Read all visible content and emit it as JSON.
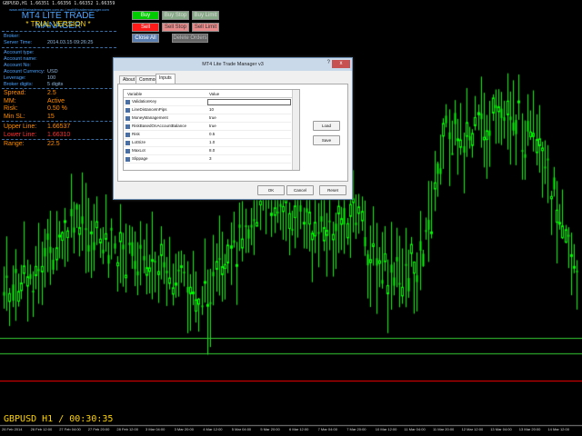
{
  "top_bar": "GBPUSD,H1  1.66351  1.66356  1.66352  1.66359",
  "panel": {
    "header": "www.mt4litetrademanager.com.au  |  mail@tradermanager.com",
    "title": "MT4 LITE TRADE MANAGER",
    "subtitle": "* TRIAL VERSION *",
    "broker_label": "Broker:",
    "broker_value": "",
    "server_time_label": "Server Time:",
    "server_time_value": "2014.03.15 09:26:25",
    "account_rows": [
      {
        "label": "Account type:",
        "value": ""
      },
      {
        "label": "Account name:",
        "value": ""
      },
      {
        "label": "Account No:",
        "value": ""
      },
      {
        "label": "Account Currency:",
        "value": "USD"
      },
      {
        "label": "Leverage:",
        "value": "100"
      },
      {
        "label": "Broker digits:",
        "value": "5 digits"
      }
    ],
    "stats": [
      {
        "label": "Spread:",
        "value": "2.5"
      },
      {
        "label": "MM:",
        "value": "Active"
      },
      {
        "label": "Risk:",
        "value": "0.50 %"
      },
      {
        "label": "Min SL:",
        "value": "15"
      }
    ],
    "upper_line_label": "Upper Line:",
    "upper_line_value": "1.66537",
    "lower_line_label": "Lower Line:",
    "lower_line_value": "1.66310",
    "range_label": "Range:",
    "range_value": "22.5"
  },
  "buttons": {
    "buy": "Buy",
    "buy_stop": "Buy Stop",
    "buy_limit": "Buy Limit",
    "sell": "Sell",
    "sell_stop": "Sell Stop",
    "sell_limit": "Sell Limit",
    "close_all": "Close All",
    "delete_orders": "Delete Orders"
  },
  "dialog": {
    "title": "MT4 Lite Trade Manager v3",
    "help": "?",
    "close": "x",
    "tabs": [
      "About",
      "Common",
      "Inputs"
    ],
    "col_variable": "Variable",
    "col_value": "Value",
    "rows": [
      {
        "name": "ValidationKey",
        "value": ""
      },
      {
        "name": "LineDistanceInPips",
        "value": "10"
      },
      {
        "name": "MoneyManagement",
        "value": "true"
      },
      {
        "name": "RiskBasedOnAccountBalance",
        "value": "true"
      },
      {
        "name": "Risk",
        "value": "0.5"
      },
      {
        "name": "LotSize",
        "value": "1.0"
      },
      {
        "name": "MaxLot",
        "value": "8.0"
      },
      {
        "name": "Slippage",
        "value": "3"
      }
    ],
    "load": "Load",
    "save": "Save",
    "ok": "OK",
    "cancel": "Cancel",
    "reset": "Reset"
  },
  "bottom_label": "GBPUSD H1 / 00:30:35",
  "x_axis": [
    "26 Feb 2014",
    "26 Feb 12:00",
    "27 Feb 04:00",
    "27 Feb 20:00",
    "28 Feb 12:00",
    "3 Mar 04:00",
    "3 Mar 20:00",
    "4 Mar 12:00",
    "5 Mar 04:00",
    "5 Mar 20:00",
    "6 Mar 12:00",
    "7 Mar 04:00",
    "7 Mar 20:00",
    "10 Mar 12:00",
    "11 Mar 04:00",
    "11 Mar 20:00",
    "12 Mar 12:00",
    "13 Mar 04:00",
    "13 Mar 20:00",
    "14 Mar 12:00"
  ],
  "colors": {
    "candle": "#00ff00",
    "upper_line": "#33cc33",
    "lower_line": "#ff0000",
    "panel_text": "#4aa3ff",
    "orange_text": "#ff8c00",
    "yellow_text": "#ffd400",
    "buy": "#00cc00",
    "sell": "#ff1a1a"
  }
}
